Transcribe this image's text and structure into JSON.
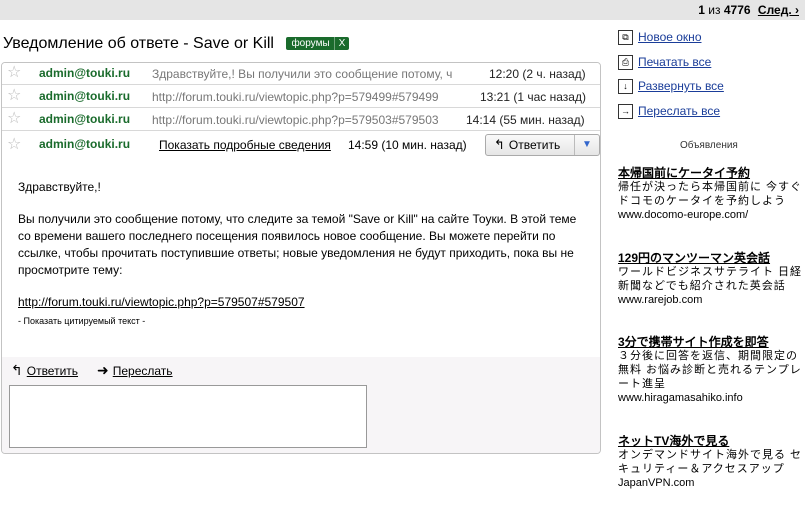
{
  "pager": {
    "position": "1",
    "of": "из",
    "total": "4776",
    "next": "След. ›"
  },
  "subject": "Уведомление об ответе - Save or Kill",
  "label": {
    "name": "форумы",
    "remove": "X"
  },
  "messages": [
    {
      "sender": "admin@touki.ru",
      "snippet": "Здравствуйте,! Вы получили это сообщение потому, ч",
      "time": "12:20 (2 ч. назад)"
    },
    {
      "sender": "admin@touki.ru",
      "snippet": "http://forum.touki.ru/viewtopic.php?p=579499#579499",
      "time": "13:21 (1 час назад)"
    },
    {
      "sender": "admin@touki.ru",
      "snippet": "http://forum.touki.ru/viewtopic.php?p=579503#579503",
      "time": "14:14 (55 мин. назад)"
    }
  ],
  "open_message": {
    "sender": "admin@touki.ru",
    "details_link": "Показать подробные сведения",
    "time": "14:59 (10 мин. назад)",
    "reply_button": "Ответить",
    "greeting": "Здравствуйте,!",
    "body": "Вы получили это сообщение потому, что следите за темой \"Save or Kill\" на сайте Тоуки. В этой теме со времени вашего последнего посещения появилось новое сообщение. Вы можете перейти по ссылке, чтобы прочитать поступившие ответы; новые уведомления не будут приходить, пока вы не просмотрите тему:",
    "link": "http://forum.touki.ru/viewtopic.php?p=579507#579507",
    "show_quoted": "- Показать цитируемый текст -"
  },
  "reply_actions": {
    "reply": "Ответить",
    "forward": "Переслать"
  },
  "side_actions": [
    {
      "label": "Новое окно",
      "icon": "new-window-icon"
    },
    {
      "label": "Печатать все",
      "icon": "print-icon"
    },
    {
      "label": "Развернуть все",
      "icon": "expand-icon"
    },
    {
      "label": "Переслать все",
      "icon": "forward-icon"
    }
  ],
  "ads_title": "Объявления",
  "ads": [
    {
      "headline": "本帰国前にケータイ予約",
      "desc": "帰任が決ったら本帰国前に 今すぐドコモのケータイを予約しよう",
      "url": "www.docomo-europe.com/"
    },
    {
      "headline": "129円のマンツーマン英会話",
      "desc": "ワールドビジネスサテライト 日経新聞などでも紹介された英会話",
      "url": "www.rarejob.com"
    },
    {
      "headline": "3分で携帯サイト作成を即答",
      "desc": "３分後に回答を返信、期間限定の無料 お悩み診断と売れるテンプレート進呈",
      "url": "www.hiragamasahiko.info"
    },
    {
      "headline": "ネットTV海外で見る",
      "desc": "オンデマンドサイト海外で見る セキュリティー＆アクセスアップ",
      "url": "JapanVPN.com"
    }
  ]
}
